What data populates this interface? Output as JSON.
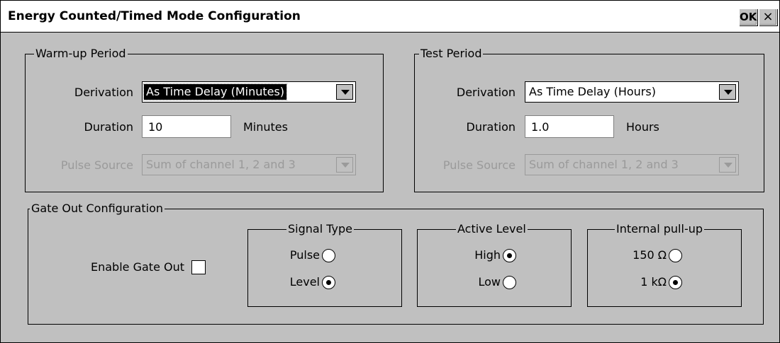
{
  "window": {
    "title": "Energy Counted/Timed Mode Configuration",
    "ok_label": "OK",
    "close_label": "×"
  },
  "warmup": {
    "legend": "Warm-up Period",
    "derivation_label": "Derivation",
    "derivation_value": "As Time Delay (Minutes)",
    "duration_label": "Duration",
    "duration_value": "10",
    "duration_unit": "Minutes",
    "pulse_source_label": "Pulse Source",
    "pulse_source_value": "Sum of channel 1, 2 and 3"
  },
  "test": {
    "legend": "Test Period",
    "derivation_label": "Derivation",
    "derivation_value": "As Time Delay (Hours)",
    "duration_label": "Duration",
    "duration_value": "1.0",
    "duration_unit": "Hours",
    "pulse_source_label": "Pulse Source",
    "pulse_source_value": "Sum of channel 1, 2 and 3"
  },
  "gate_out": {
    "legend": "Gate Out Configuration",
    "enable_label": "Enable Gate Out",
    "enable_checked": false,
    "signal_type": {
      "legend": "Signal Type",
      "options": [
        "Pulse",
        "Level"
      ],
      "selected": "Level"
    },
    "active_level": {
      "legend": "Active Level",
      "options": [
        "High",
        "Low"
      ],
      "selected": "High"
    },
    "pullup": {
      "legend": "Internal pull-up",
      "options": [
        "150 Ω",
        "1 kΩ"
      ],
      "selected": "1 kΩ"
    }
  }
}
